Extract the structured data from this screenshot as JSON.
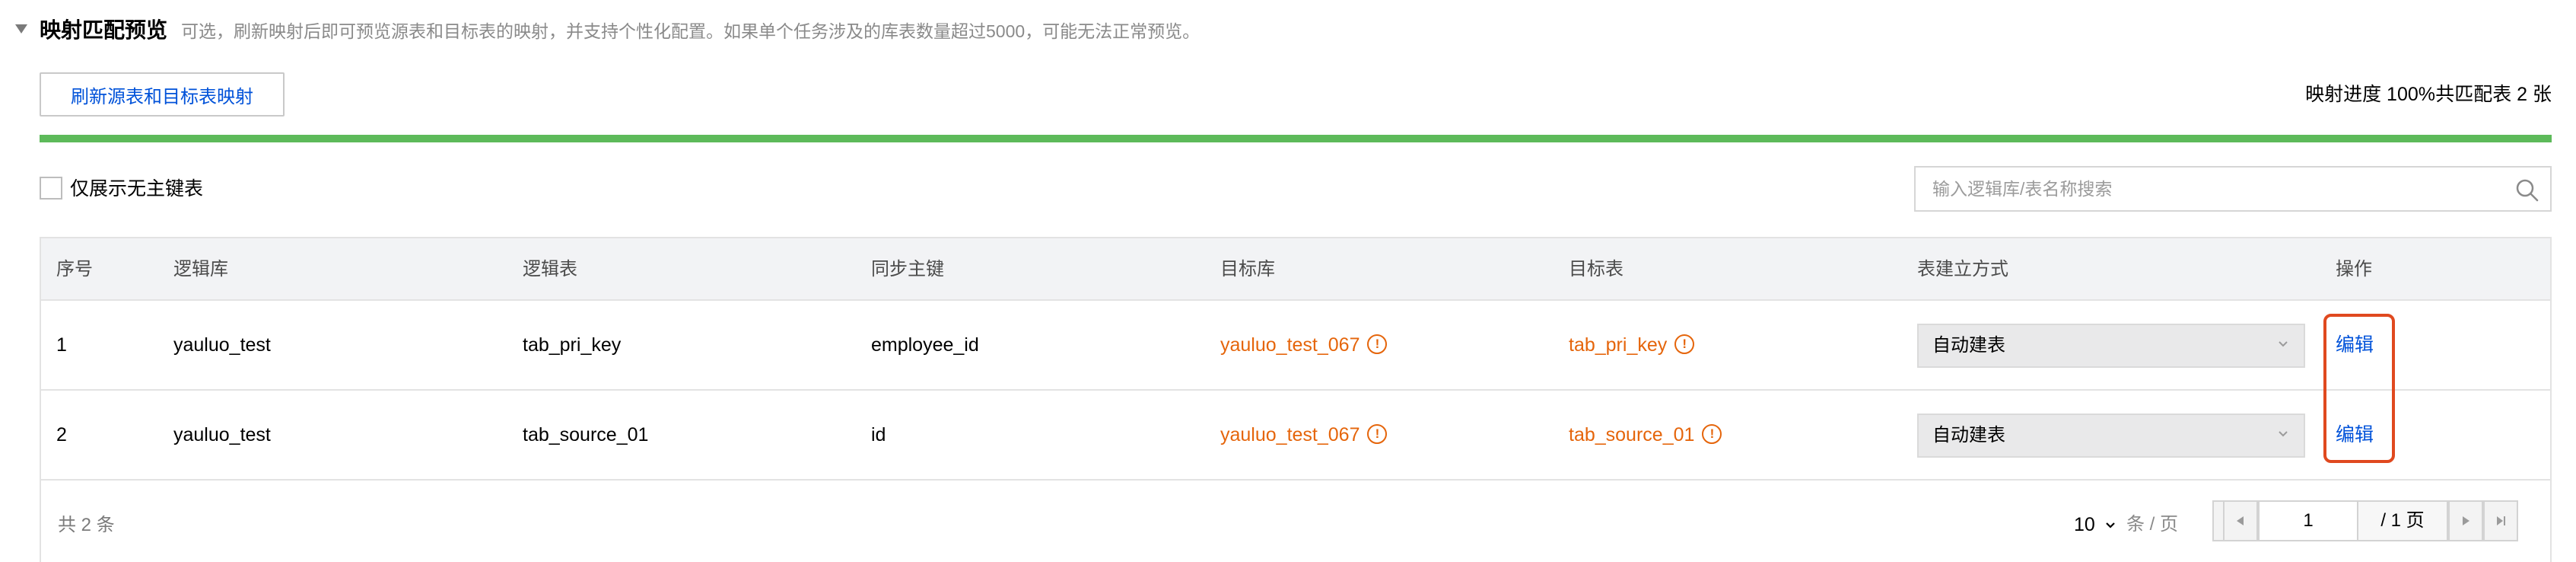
{
  "section": {
    "title": "映射匹配预览",
    "hint": "可选，刷新映射后即可预览源表和目标表的映射，并支持个性化配置。如果单个任务涉及的库表数量超过5000，可能无法正常预览。"
  },
  "toolbar": {
    "refresh_label": "刷新源表和目标表映射",
    "progress_text": "映射进度 100%",
    "matched_text": "共匹配表 2 张",
    "progress": 1.0,
    "progress_color": "#5dba5a"
  },
  "filter": {
    "only_no_pk_label": "仅展示无主键表",
    "search_placeholder": "输入逻辑库/表名称搜索"
  },
  "table": {
    "headers": [
      "序号",
      "逻辑库",
      "逻辑表",
      "同步主键",
      "目标库",
      "目标表",
      "表建立方式",
      "操作"
    ],
    "rows": [
      {
        "index": "1",
        "logic_db": "yauluo_test",
        "logic_table": "tab_pri_key",
        "sync_pk": "employee_id",
        "target_db": "yauluo_test_067",
        "target_table": "tab_pri_key",
        "create_mode": "自动建表",
        "action": "编辑"
      },
      {
        "index": "2",
        "logic_db": "yauluo_test",
        "logic_table": "tab_source_01",
        "sync_pk": "id",
        "target_db": "yauluo_test_067",
        "target_table": "tab_source_01",
        "create_mode": "自动建表",
        "action": "编辑"
      }
    ],
    "warning_glyph": "!"
  },
  "pagination": {
    "total": "共 2 条",
    "page_size": "10",
    "page_size_unit": "条 / 页",
    "current_page": "1",
    "total_pages": "/ 1 页"
  },
  "colors": {
    "link": "#0052d9",
    "warning": "#e5650b",
    "highlight": "#e0491f"
  }
}
